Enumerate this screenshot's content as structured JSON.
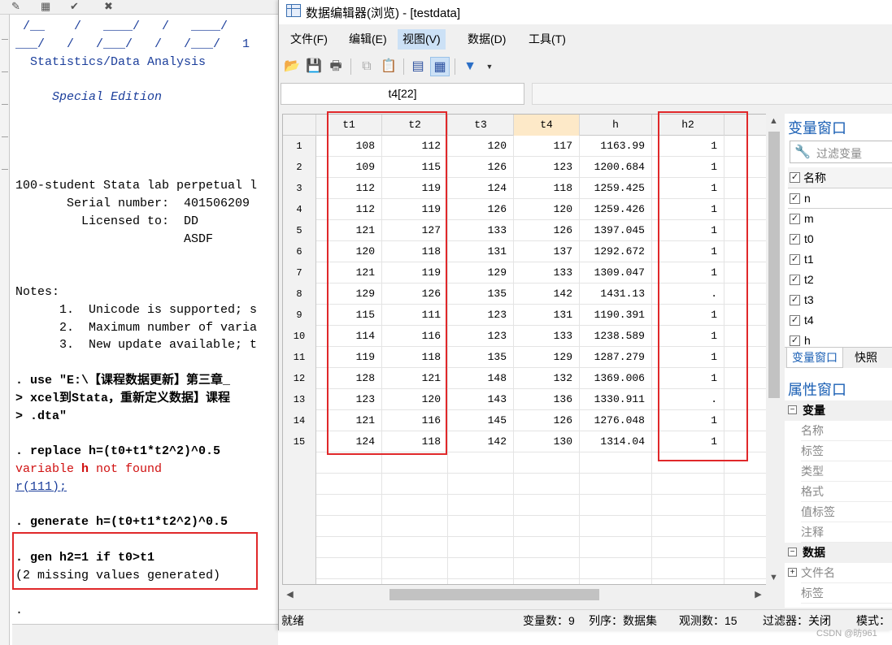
{
  "stata": {
    "results_lines": [
      {
        "text": " /__    /   ____/   /   ____/",
        "style": "blue"
      },
      {
        "text": "___/   /   /___/   /   /___/   1",
        "style": "blue"
      },
      {
        "text": "  Statistics/Data Analysis",
        "style": "blue"
      },
      {
        "text": "",
        "style": ""
      },
      {
        "text": "     Special Edition",
        "style": "it"
      },
      {
        "text": "",
        "style": ""
      },
      {
        "text": "",
        "style": ""
      },
      {
        "text": "",
        "style": ""
      },
      {
        "text": "",
        "style": ""
      },
      {
        "text": "100-student Stata lab perpetual l",
        "style": ""
      },
      {
        "text": "       Serial number:  401506209",
        "style": ""
      },
      {
        "text": "         Licensed to:  DD",
        "style": ""
      },
      {
        "text": "                       ASDF",
        "style": ""
      },
      {
        "text": "",
        "style": ""
      },
      {
        "text": "",
        "style": ""
      },
      {
        "text": "Notes:",
        "style": ""
      },
      {
        "text": "      1.  Unicode is supported; s",
        "style": ""
      },
      {
        "text": "      2.  Maximum number of varia",
        "style": ""
      },
      {
        "text": "      3.  New update available; t",
        "style": ""
      },
      {
        "text": "",
        "style": ""
      },
      {
        "text": ". use \"E:\\【课程数据更新】第三章_",
        "style": "bold"
      },
      {
        "text": "> xcel到Stata，重新定义数据】课程",
        "style": "bold"
      },
      {
        "text": "> .dta\"",
        "style": "bold"
      },
      {
        "text": "",
        "style": ""
      },
      {
        "text": ". replace h=(t0+t1*t2^2)^0.5",
        "style": "bold"
      },
      {
        "text": "variable h not found",
        "style": "red"
      },
      {
        "text": "r(111);",
        "style": "link"
      },
      {
        "text": "",
        "style": ""
      },
      {
        "text": ". generate h=(t0+t1*t2^2)^0.5",
        "style": "bold"
      },
      {
        "text": "",
        "style": ""
      },
      {
        "text": ". gen h2=1 if t0>t1",
        "style": "bold"
      },
      {
        "text": "(2 missing values generated)",
        "style": ""
      },
      {
        "text": "",
        "style": ""
      },
      {
        "text": ".",
        "style": ""
      }
    ]
  },
  "editor": {
    "title": "数据编辑器(浏览) - [testdata]",
    "menus": [
      "文件(F)",
      "编辑(E)",
      "视图(V)",
      "数据(D)",
      "工具(T)"
    ],
    "active_menu": "视图(V)",
    "cell_reference": "t4[22]",
    "grid": {
      "columns": [
        "t1",
        "t2",
        "t3",
        "t4",
        "h",
        "h2"
      ],
      "selected_column": "t4",
      "rows": [
        [
          "1",
          "108",
          "112",
          "120",
          "117",
          "1163.99",
          "1"
        ],
        [
          "2",
          "109",
          "115",
          "126",
          "123",
          "1200.684",
          "1"
        ],
        [
          "3",
          "112",
          "119",
          "124",
          "118",
          "1259.425",
          "1"
        ],
        [
          "4",
          "112",
          "119",
          "126",
          "120",
          "1259.426",
          "1"
        ],
        [
          "5",
          "121",
          "127",
          "133",
          "126",
          "1397.045",
          "1"
        ],
        [
          "6",
          "120",
          "118",
          "131",
          "137",
          "1292.672",
          "1"
        ],
        [
          "7",
          "121",
          "119",
          "129",
          "133",
          "1309.047",
          "1"
        ],
        [
          "8",
          "129",
          "126",
          "135",
          "142",
          "1431.13",
          "."
        ],
        [
          "9",
          "115",
          "111",
          "123",
          "131",
          "1190.391",
          "1"
        ],
        [
          "10",
          "114",
          "116",
          "123",
          "133",
          "1238.589",
          "1"
        ],
        [
          "11",
          "119",
          "118",
          "135",
          "129",
          "1287.279",
          "1"
        ],
        [
          "12",
          "128",
          "121",
          "148",
          "132",
          "1369.006",
          "1"
        ],
        [
          "13",
          "123",
          "120",
          "143",
          "136",
          "1330.911",
          "."
        ],
        [
          "14",
          "121",
          "116",
          "145",
          "126",
          "1276.048",
          "1"
        ],
        [
          "15",
          "124",
          "118",
          "142",
          "130",
          "1314.04",
          "1"
        ]
      ]
    },
    "status": {
      "ready": "就绪",
      "var_count": "变量数：9",
      "order": "列序：数据集",
      "obs_count": "观测数：15",
      "filter": "过滤器：关闭",
      "mode": "模式："
    },
    "variables_panel": {
      "title": "变量窗口",
      "filter_placeholder": "过滤变量",
      "name_header": "名称",
      "variables": [
        "n",
        "m",
        "t0",
        "t1",
        "t2",
        "t3",
        "t4",
        "h"
      ],
      "tabs": [
        "变量窗口",
        "快照"
      ]
    },
    "properties_panel": {
      "title": "属性窗口",
      "groups": [
        {
          "name": "变量",
          "items": [
            "名称",
            "标签",
            "类型",
            "格式",
            "值标签",
            "注释"
          ]
        },
        {
          "name": "数据",
          "items": [
            "文件名",
            "标签"
          ]
        }
      ]
    }
  },
  "watermark": "CSDN @昉961"
}
